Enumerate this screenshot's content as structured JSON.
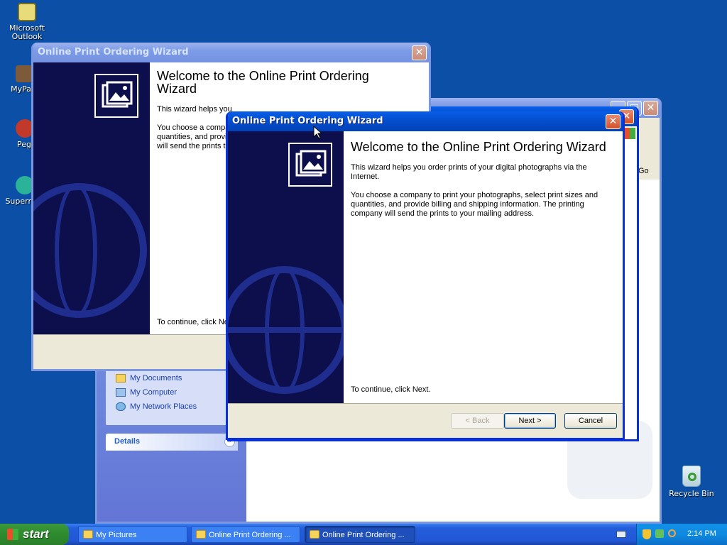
{
  "desktop_icons": [
    {
      "label": "Microsoft Outlook",
      "icon": "outlook-icon"
    },
    {
      "label": "MyPa",
      "icon": "shortcut-icon"
    },
    {
      "label": "Peg",
      "icon": "shortcut-icon"
    },
    {
      "label": "Superr",
      "icon": "shortcut-icon"
    },
    {
      "label": "Recycle Bin",
      "icon": "recycle-bin-icon"
    }
  ],
  "explorer": {
    "address_go": "Go",
    "other_places": [
      "My Documents",
      "My Computer",
      "My Network Places"
    ],
    "details_label": "Details"
  },
  "wizard_back": {
    "title": "Online Print Ordering Wizard",
    "heading": "Welcome to the Online Print Ordering Wizard",
    "para1": "This wizard helps you",
    "para2_lines": [
      "You choose a compa",
      "quantities, and provid",
      "will send the prints to"
    ],
    "continue": "To continue, click Ne"
  },
  "wizard_front": {
    "title": "Online Print Ordering Wizard",
    "heading": "Welcome to the Online Print Ordering Wizard",
    "para1": "This wizard helps you order prints of your digital photographs via the Internet.",
    "para2": "You choose a company to print your photographs, select print sizes and quantities, and provide billing and shipping information. The printing company will send the prints to your mailing address.",
    "continue": "To continue, click Next.",
    "buttons": {
      "back": "< Back",
      "next": "Next >",
      "cancel": "Cancel"
    }
  },
  "taskbar": {
    "start": "start",
    "tasks": [
      "My Pictures",
      "Online Print Ordering ...",
      "Online Print Ordering ..."
    ],
    "clock": "2:14 PM"
  },
  "colors": {
    "desktop": "#0b50a6",
    "title_active": "#0450d0",
    "wizard_side": "#0c0f4c"
  }
}
